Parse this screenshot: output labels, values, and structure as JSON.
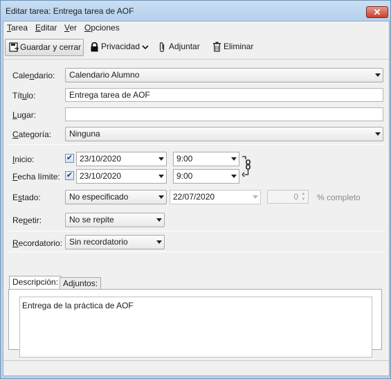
{
  "window": {
    "title": "Editar tarea: Entrega tarea de AOF"
  },
  "menu": [
    {
      "label": "Tarea",
      "access": "T",
      "rest": "area"
    },
    {
      "label": "Editar",
      "access": "E",
      "rest": "ditar"
    },
    {
      "label": "Ver",
      "access": "V",
      "rest": "er"
    },
    {
      "label": "Opciones",
      "access": "O",
      "rest": "pciones"
    }
  ],
  "toolbar": {
    "save_close": "Guardar y cerrar",
    "privacy": "Privacidad",
    "attach": "Adjuntar",
    "delete": "Eliminar"
  },
  "form": {
    "calendar_label": "Calendario:",
    "calendar_value": "Calendario Alumno",
    "title_label": "Título:",
    "title_value": "Entrega tarea de AOF",
    "location_label": "Lugar:",
    "location_value": "",
    "category_label": "Categoría:",
    "category_value": "Ninguna",
    "start_label": "Inicio:",
    "start_checked": true,
    "start_date": "23/10/2020",
    "start_time": "9:00",
    "due_label": "Fecha límite:",
    "due_checked": true,
    "due_date": "23/10/2020",
    "due_time": "9:00",
    "status_label": "Estado:",
    "status_value": "No especificado",
    "status_date": "22/07/2020",
    "percent_value": "0",
    "percent_label": "% completo",
    "repeat_label": "Repetir:",
    "repeat_value": "No se repite",
    "reminder_label": "Recordatorio:",
    "reminder_value": "Sin recordatorio"
  },
  "tabs": {
    "description": "Descripción:",
    "attachments": "Adjuntos:"
  },
  "description_text": "Entrega de la práctica de AOF",
  "colors": {
    "accent": "#b9d4ee",
    "close": "#c9412d"
  }
}
